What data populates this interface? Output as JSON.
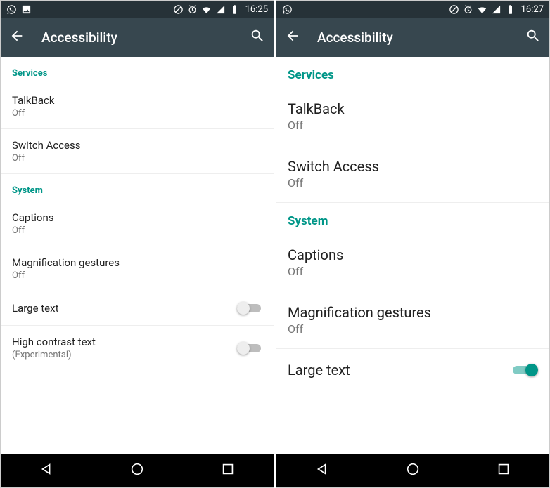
{
  "left": {
    "status_time": "16:25",
    "appbar_title": "Accessibility",
    "sections": {
      "services": {
        "header": "Services",
        "items": [
          {
            "title": "TalkBack",
            "sub": "Off"
          },
          {
            "title": "Switch Access",
            "sub": "Off"
          }
        ]
      },
      "system": {
        "header": "System",
        "items": [
          {
            "title": "Captions",
            "sub": "Off"
          },
          {
            "title": "Magnification gestures",
            "sub": "Off"
          },
          {
            "title": "Large text",
            "switch": "off"
          },
          {
            "title": "High contrast text",
            "sub": "(Experimental)",
            "switch": "off"
          }
        ]
      }
    }
  },
  "right": {
    "status_time": "16:27",
    "appbar_title": "Accessibility",
    "sections": {
      "services": {
        "header": "Services",
        "items": [
          {
            "title": "TalkBack",
            "sub": "Off"
          },
          {
            "title": "Switch Access",
            "sub": "Off"
          }
        ]
      },
      "system": {
        "header": "System",
        "items": [
          {
            "title": "Captions",
            "sub": "Off"
          },
          {
            "title": "Magnification gestures",
            "sub": "Off"
          },
          {
            "title": "Large text",
            "switch": "on"
          }
        ]
      }
    }
  }
}
